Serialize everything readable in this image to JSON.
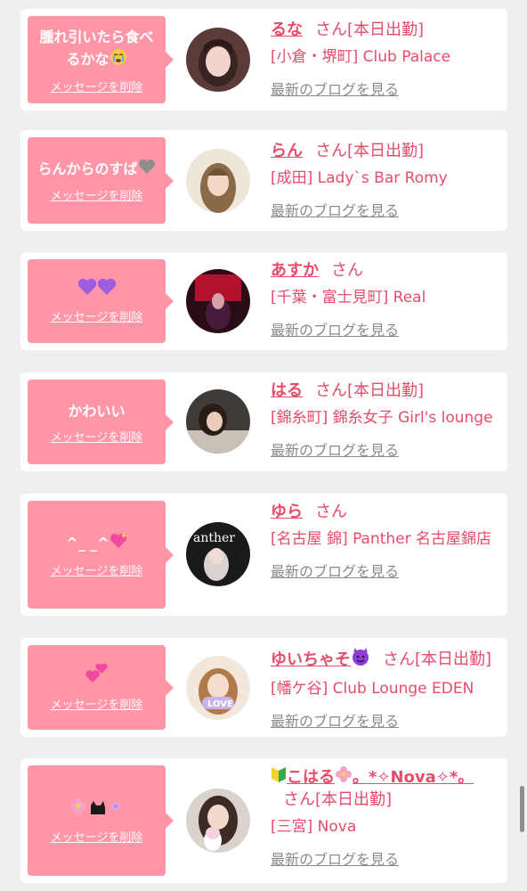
{
  "delete_label": "メッセージを削除",
  "blog_label": "最新のブログを見る",
  "san_label": "さん",
  "colors": {
    "accent": "#e74c6a",
    "bubble": "#ff96a8",
    "background": "#efefef",
    "link_gray": "#8a8a8a"
  },
  "entries": [
    {
      "message": "腫れ引いたら食べるかな",
      "message_emoji": "crying-face",
      "name": "るな",
      "status": "[本日出勤]",
      "shop": "[小倉・堺町] Club Palace"
    },
    {
      "message": "らんからのすば",
      "message_emoji": "grey-heart",
      "name": "らん",
      "status": "[本日出勤]",
      "shop": "[成田] Lady`s Bar Romy"
    },
    {
      "message": "",
      "message_emoji": "purple-hearts",
      "name": "あすか",
      "status": "",
      "shop": "[千葉・富士見町] Real"
    },
    {
      "message": "かわいい",
      "message_emoji": "",
      "name": "はる",
      "status": "[本日出勤]",
      "shop": "[錦糸町] 錦糸女子 Girl's lounge"
    },
    {
      "message": "^_ _^",
      "message_emoji": "sparkling-heart",
      "name": "ゆら",
      "status": "",
      "shop": "[名古屋 錦] Panther 名古屋錦店"
    },
    {
      "message": "",
      "message_emoji": "two-hearts",
      "name": "ゆいちゃそ",
      "name_emoji": "smiling-devil",
      "status": "[本日出勤]",
      "shop": "[幡ケ谷] Club Lounge EDEN"
    },
    {
      "message": "",
      "message_emoji": "blossom-cat-ribbon",
      "name": "こはる",
      "name_emoji": "beginner-flower",
      "name_suffix": "。*✧Nova✧*。",
      "status": "[本日出勤]",
      "shop": "[三宮] Nova"
    }
  ]
}
